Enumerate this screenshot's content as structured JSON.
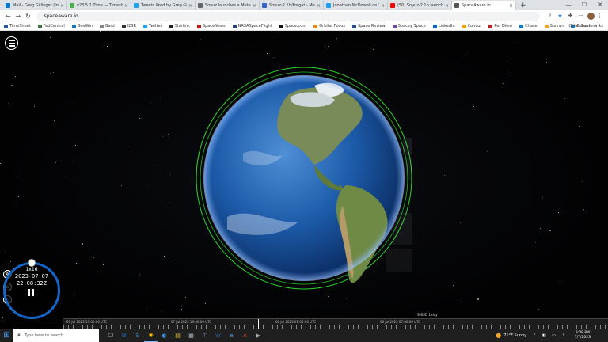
{
  "browser": {
    "tabs": [
      {
        "title": "Mail - Greg Gillinger (Ima",
        "color": "#0078d4",
        "active": false
      },
      {
        "title": "v23.5.1 Time — Timesheet",
        "color": "#4caf50",
        "active": false
      },
      {
        "title": "Tweets liked by Greg Gilli",
        "color": "#1da1f2",
        "active": false
      },
      {
        "title": "Soyuz launches a Meteor",
        "color": "#666666",
        "active": false
      },
      {
        "title": "Soyuz-2.1b/Fregat - Meteo",
        "color": "#3366cc",
        "active": false
      },
      {
        "title": "Jonathan McDowell on Tw",
        "color": "#1da1f2",
        "active": false
      },
      {
        "title": "(50) Soyuz-2.1b launches",
        "color": "#ff0000",
        "active": false
      },
      {
        "title": "SpaceAware.io",
        "color": "#555555",
        "active": true
      }
    ],
    "url": "spaceaware.io",
    "bookmarks": [
      {
        "label": "TimeSheet",
        "color": "#2b5797"
      },
      {
        "label": "FedCentral",
        "color": "#3c6e47"
      },
      {
        "label": "GovWin",
        "color": "#1b75bb"
      },
      {
        "label": "Bard",
        "color": "#888888"
      },
      {
        "label": "I2SR",
        "color": "#333333"
      },
      {
        "label": "Twitter",
        "color": "#1da1f2"
      },
      {
        "label": "Starlink",
        "color": "#222222"
      },
      {
        "label": "SpaceNews",
        "color": "#c4161c"
      },
      {
        "label": "NASASpaceFlight",
        "color": "#2c3e75"
      },
      {
        "label": "Space.com",
        "color": "#111111"
      },
      {
        "label": "Orbital Focus",
        "color": "#e08a1e"
      },
      {
        "label": "Space Review",
        "color": "#2a4c8a"
      },
      {
        "label": "Spacey Space",
        "color": "#6b4aa0"
      },
      {
        "label": "LinkedIn",
        "color": "#0a66c2"
      },
      {
        "label": "Concur",
        "color": "#f4a300"
      },
      {
        "label": "Per Diem",
        "color": "#b22222"
      },
      {
        "label": "Chase",
        "color": "#117aca"
      },
      {
        "label": "Sunrun",
        "color": "#f5a623"
      },
      {
        "label": "Edison",
        "color": "#2a7fbf"
      }
    ],
    "other_bookmarks": "Other bookmarks"
  },
  "app": {
    "sim_speed": "1x16",
    "date": "2023-07-07",
    "time": "22:08:32Z",
    "speed_control": "SPEED 1 day",
    "timeline_labels": [
      "07 Jul 2023 13:00:00 UTC",
      "07 Jul 2023 19:00:00 UTC",
      "08 Jul 2023 01:00:00 UTC",
      "08 Jul 2023 07:00:00 UTC"
    ]
  },
  "taskbar": {
    "search_placeholder": "Type here to search",
    "weather": "71°F  Sunny",
    "clock_time": "3:08 PM",
    "clock_date": "7/7/2023"
  }
}
